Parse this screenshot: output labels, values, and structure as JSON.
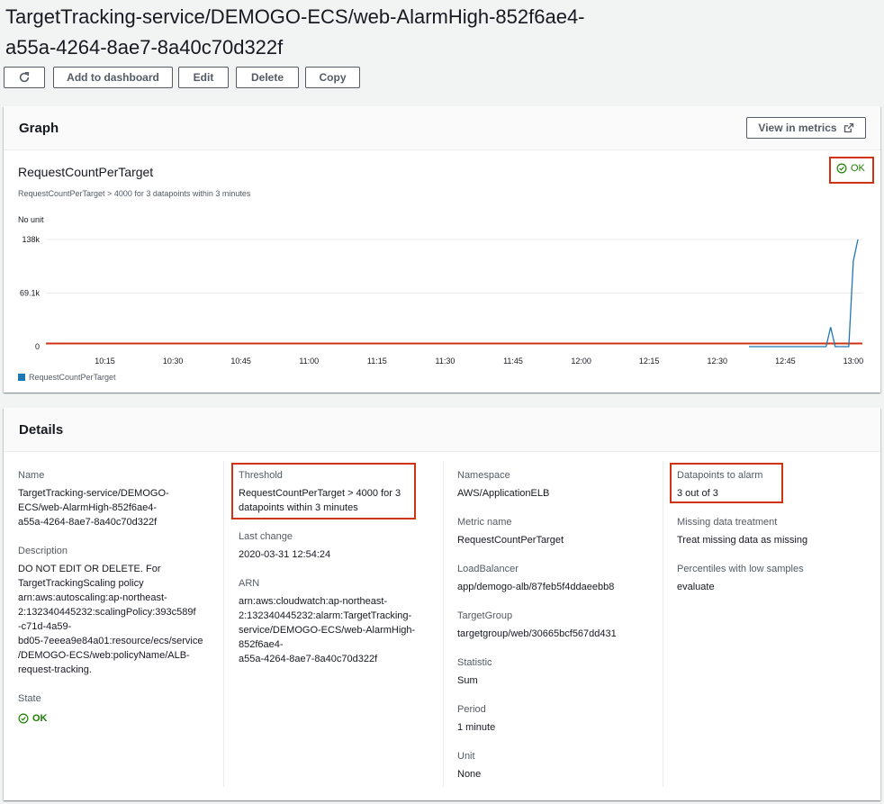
{
  "page": {
    "title_line1": "TargetTracking-service/DEMOGO-ECS/web-AlarmHigh-852f6ae4-",
    "title_line2": "a55a-4264-8ae7-8a40c70d322f"
  },
  "toolbar": {
    "refresh_icon": "refresh-icon",
    "add_to_dashboard": "Add to dashboard",
    "edit": "Edit",
    "delete": "Delete",
    "copy": "Copy"
  },
  "graph_panel": {
    "header": "Graph",
    "view_in_metrics": "View in metrics",
    "external_icon": "external-link-icon",
    "metric_title": "RequestCountPerTarget",
    "condition": "RequestCountPerTarget > 4000 for 3 datapoints within 3 minutes",
    "unit_label": "No unit",
    "state": "OK",
    "state_icon": "check-circle-icon"
  },
  "chart_data": {
    "type": "line",
    "x_ticks": [
      "10:15",
      "10:30",
      "10:45",
      "11:00",
      "11:15",
      "11:30",
      "11:45",
      "12:00",
      "12:15",
      "12:30",
      "12:45",
      "13:00"
    ],
    "y_ticks": [
      "138k",
      "69.1k",
      "0"
    ],
    "ylim": [
      0,
      138000
    ],
    "xlim": [
      "10:02",
      "13:02"
    ],
    "threshold": 4000,
    "threshold_color": "#d13212",
    "grid": "horizontal",
    "legend_position": "bottom-left",
    "series": [
      {
        "name": "RequestCountPerTarget",
        "color": "#1f77b4",
        "x": [
          "12:37",
          "12:40",
          "12:43",
          "12:46",
          "12:49",
          "12:52",
          "12:54",
          "12:55",
          "12:56",
          "12:57",
          "12:58",
          "12:59",
          "13:00",
          "13:01"
        ],
        "values": [
          0,
          0,
          0,
          0,
          0,
          0,
          0,
          25000,
          0,
          0,
          0,
          0,
          110000,
          138000
        ]
      }
    ]
  },
  "details_panel": {
    "header": "Details",
    "name_label": "Name",
    "name_lines": [
      "TargetTracking-service/DEMOGO-",
      "ECS/web-AlarmHigh-852f6ae4-",
      "a55a-4264-8ae7-8a40c70d322f"
    ],
    "description_label": "Description",
    "description_lines": [
      "DO NOT EDIT OR DELETE. For",
      "TargetTrackingScaling policy",
      "arn:aws:autoscaling:ap-northeast-",
      "2:132340445232:scalingPolicy:393c589f",
      "-c71d-4a59-",
      "bd05-7eeea9e84a01:resource/ecs/service",
      "/DEMOGO-ECS/web:policyName/ALB-",
      "request-tracking."
    ],
    "state_label": "State",
    "state_value": "OK",
    "threshold_label": "Threshold",
    "threshold_lines": [
      "RequestCountPerTarget > 4000 for 3",
      "datapoints within 3 minutes"
    ],
    "last_change_label": "Last change",
    "last_change_value": "2020-03-31 12:54:24",
    "arn_label": "ARN",
    "arn_lines": [
      "arn:aws:cloudwatch:ap-northeast-",
      "2:132340445232:alarm:TargetTracking-",
      "service/DEMOGO-ECS/web-AlarmHigh-",
      "852f6ae4-",
      "a55a-4264-8ae7-8a40c70d322f"
    ],
    "namespace_label": "Namespace",
    "namespace_value": "AWS/ApplicationELB",
    "metric_name_label": "Metric name",
    "metric_name_value": "RequestCountPerTarget",
    "loadbalancer_label": "LoadBalancer",
    "loadbalancer_value": "app/demogo-alb/87feb5f4ddaeebb8",
    "targetgroup_label": "TargetGroup",
    "targetgroup_value": "targetgroup/web/30665bcf567dd431",
    "statistic_label": "Statistic",
    "statistic_value": "Sum",
    "period_label": "Period",
    "period_value": "1 minute",
    "unit_label": "Unit",
    "unit_value": "None",
    "datapoints_label": "Datapoints to alarm",
    "datapoints_value": "3 out of 3",
    "missing_label": "Missing data treatment",
    "missing_value": "Treat missing data as missing",
    "percentiles_label": "Percentiles with low samples",
    "percentiles_value": "evaluate"
  }
}
